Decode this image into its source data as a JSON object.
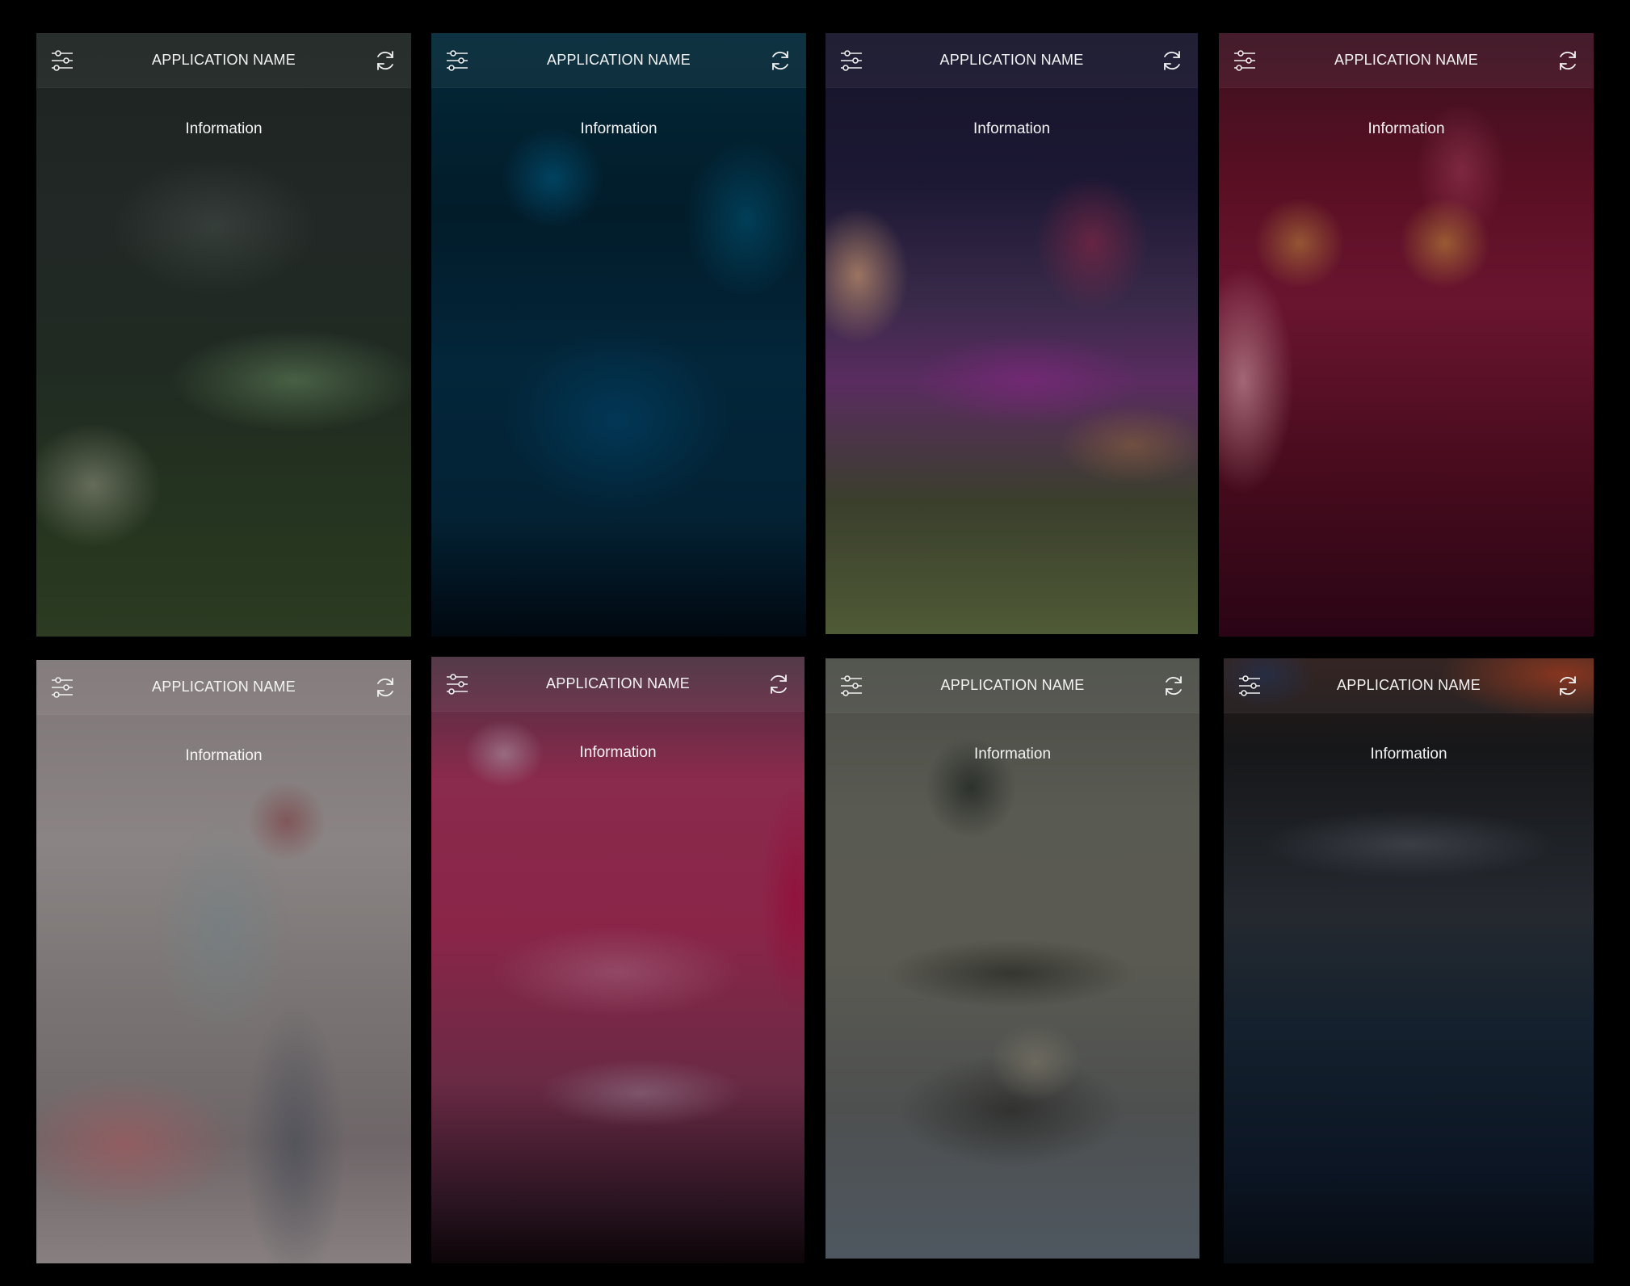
{
  "screens": [
    {
      "app_name": "APPLICATION NAME",
      "info_text": "Information",
      "left_icon": "sliders-icon",
      "right_icon": "refresh-icon",
      "theme_color": "#243324"
    },
    {
      "app_name": "APPLICATION NAME",
      "info_text": "Information",
      "left_icon": "sliders-icon",
      "right_icon": "refresh-icon",
      "theme_color": "#03263a"
    },
    {
      "app_name": "APPLICATION NAME",
      "info_text": "Information",
      "left_icon": "sliders-icon",
      "right_icon": "refresh-icon",
      "theme_color": "#5a2c60"
    },
    {
      "app_name": "APPLICATION NAME",
      "info_text": "Information",
      "left_icon": "sliders-icon",
      "right_icon": "refresh-icon",
      "theme_color": "#5a0f23"
    },
    {
      "app_name": "APPLICATION NAME",
      "info_text": "Information",
      "left_icon": "sliders-icon",
      "right_icon": "refresh-icon",
      "theme_color": "#8b8484"
    },
    {
      "app_name": "APPLICATION NAME",
      "info_text": "Information",
      "left_icon": "sliders-icon",
      "right_icon": "refresh-icon",
      "theme_color": "#8a2548"
    },
    {
      "app_name": "APPLICATION NAME",
      "info_text": "Information",
      "left_icon": "sliders-icon",
      "right_icon": "refresh-icon",
      "theme_color": "#595a52"
    },
    {
      "app_name": "APPLICATION NAME",
      "info_text": "Information",
      "left_icon": "sliders-icon",
      "right_icon": "refresh-icon",
      "theme_color": "#0b1523"
    }
  ]
}
